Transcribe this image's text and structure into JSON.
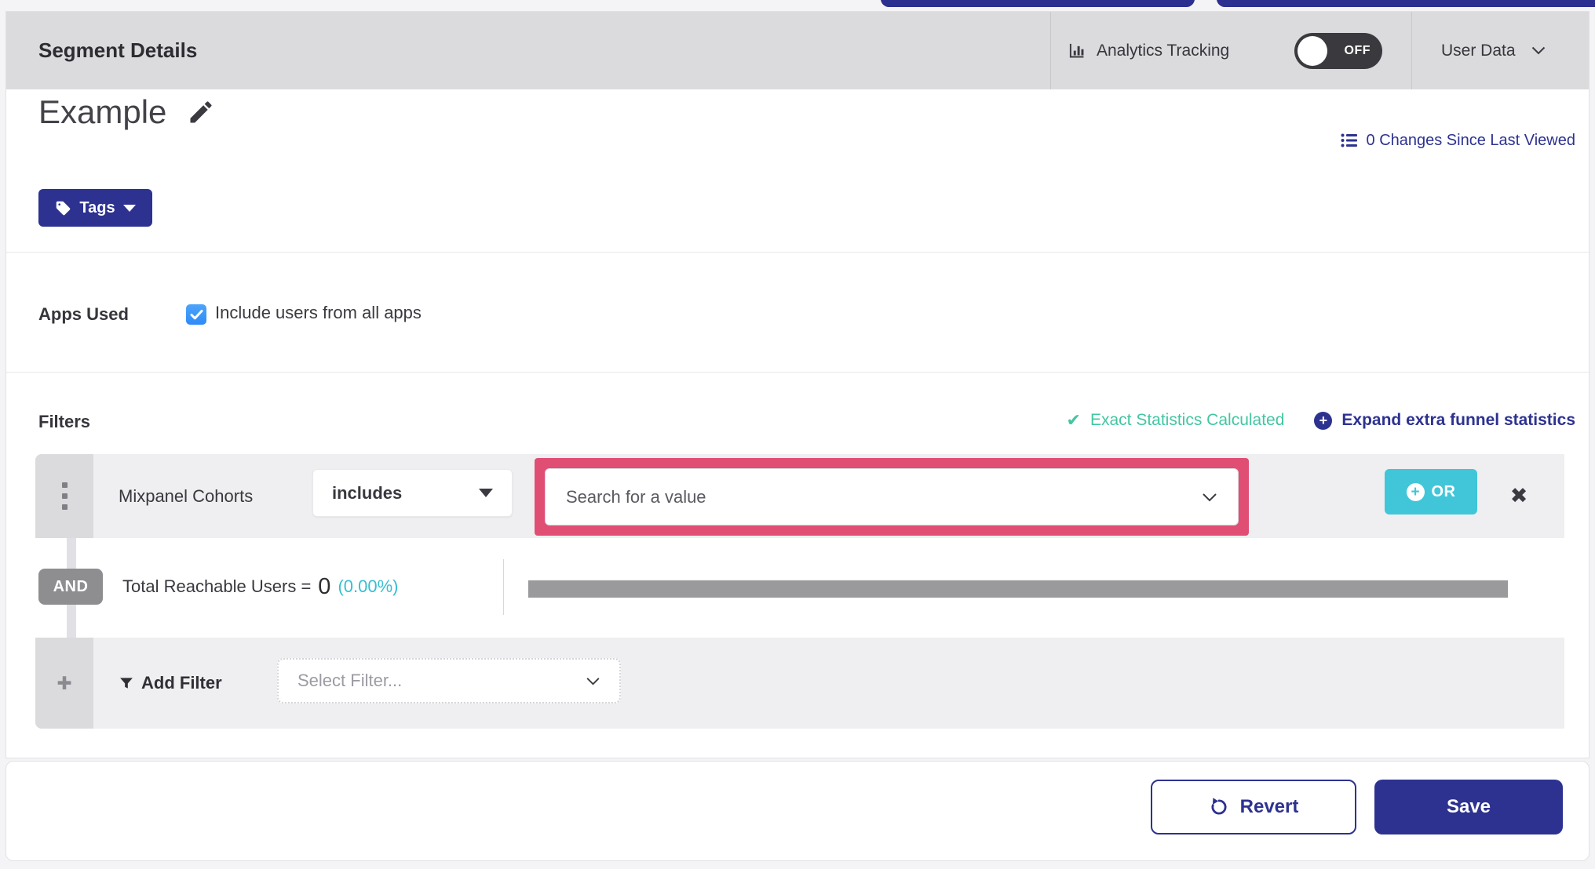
{
  "header": {
    "title": "Segment Details",
    "analytics_tracking_label": "Analytics Tracking",
    "analytics_toggle_state": "OFF",
    "user_data_label": "User Data"
  },
  "segment": {
    "name": "Example",
    "tags_button_label": "Tags",
    "changes_link_label": "0 Changes Since Last Viewed"
  },
  "apps_used": {
    "label": "Apps Used",
    "checkbox_label": "Include users from all apps",
    "checkbox_checked": true
  },
  "filters": {
    "title": "Filters",
    "exact_stats_label": "Exact Statistics Calculated",
    "expand_link_label": "Expand extra funnel statistics",
    "row1": {
      "name": "Mixpanel Cohorts",
      "operator": "includes",
      "value_placeholder": "Search for a value",
      "or_button_label": "OR"
    },
    "and_label": "AND",
    "reachable": {
      "label": "Total Reachable Users =",
      "value": "0",
      "percent": "(0.00%)"
    },
    "add_filter": {
      "label": "Add Filter",
      "select_placeholder": "Select Filter..."
    }
  },
  "footer": {
    "revert_label": "Revert",
    "save_label": "Save"
  },
  "colors": {
    "indigo": "#2d3290",
    "teal_or": "#40c6d8",
    "green_stats": "#42c6a1",
    "cyan_percent": "#35bfd2",
    "pink_highlight": "#e14e74",
    "header_gray": "#dbdbdd",
    "row_gray": "#efeff1"
  }
}
